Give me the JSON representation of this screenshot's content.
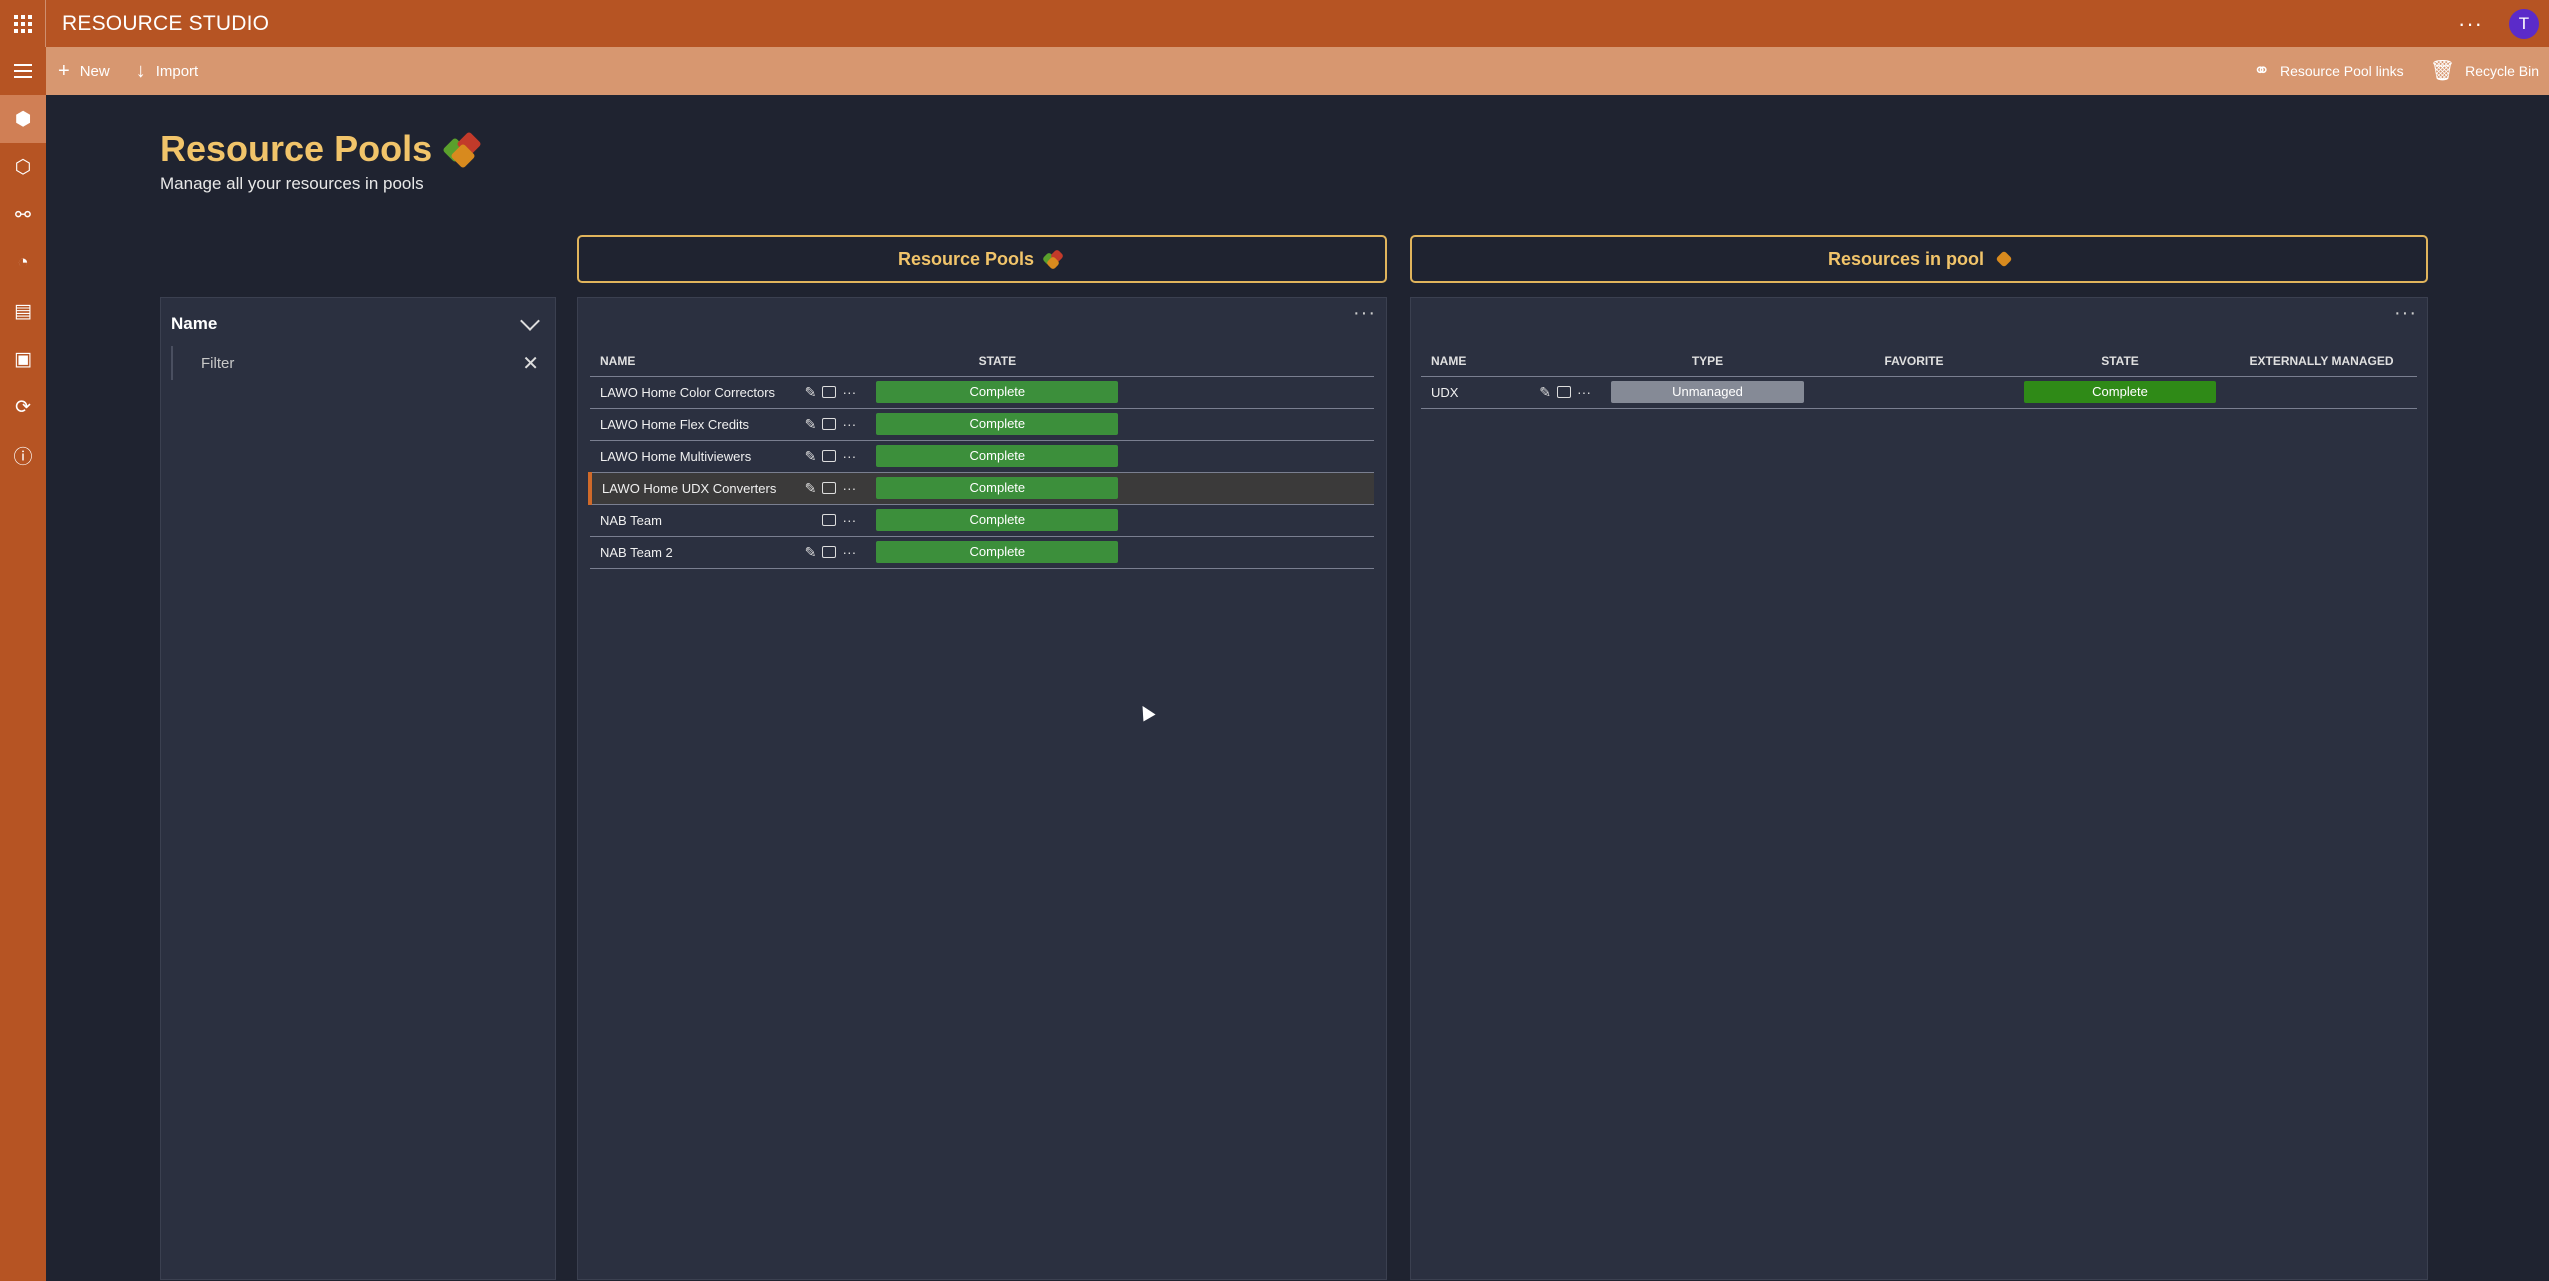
{
  "app": {
    "title": "RESOURCE STUDIO",
    "avatar_letter": "T"
  },
  "commands": {
    "new": "New",
    "import": "Import",
    "pool_links": "Resource Pool links",
    "recycle_bin": "Recycle Bin"
  },
  "rail": [
    "menu-icon",
    "resource-pools-icon",
    "cube-icon",
    "connections-icon",
    "dashboard-icon",
    "reports-icon",
    "clipboard-icon",
    "sync-icon",
    "info-icon"
  ],
  "header": {
    "title": "Resource Pools",
    "subtitle": "Manage all your resources in pools"
  },
  "filter": {
    "title": "Name",
    "placeholder": "Filter"
  },
  "pools_panel": {
    "title": "Resource Pools",
    "columns": [
      "NAME",
      "STATE"
    ],
    "rows": [
      {
        "name": "LAWO Home Color Correctors",
        "state": "Complete",
        "edit": true
      },
      {
        "name": "LAWO Home Flex Credits",
        "state": "Complete",
        "edit": true
      },
      {
        "name": "LAWO Home Multiviewers",
        "state": "Complete",
        "edit": true
      },
      {
        "name": "LAWO Home UDX Converters",
        "state": "Complete",
        "edit": true,
        "selected": true
      },
      {
        "name": "NAB Team",
        "state": "Complete",
        "edit": false
      },
      {
        "name": "NAB Team 2",
        "state": "Complete",
        "edit": true
      }
    ]
  },
  "resources_panel": {
    "title": "Resources in pool",
    "columns": [
      "NAME",
      "TYPE",
      "FAVORITE",
      "STATE",
      "EXTERNALLY MANAGED"
    ],
    "rows": [
      {
        "name": "UDX",
        "type": "Unmanaged",
        "favorite": "",
        "state": "Complete",
        "externally_managed": ""
      }
    ]
  },
  "colors": {
    "topbar": "#b65423",
    "cmdbar": "#d79770",
    "accent": "#f1c46a",
    "state_green": "#3c8f3b"
  }
}
